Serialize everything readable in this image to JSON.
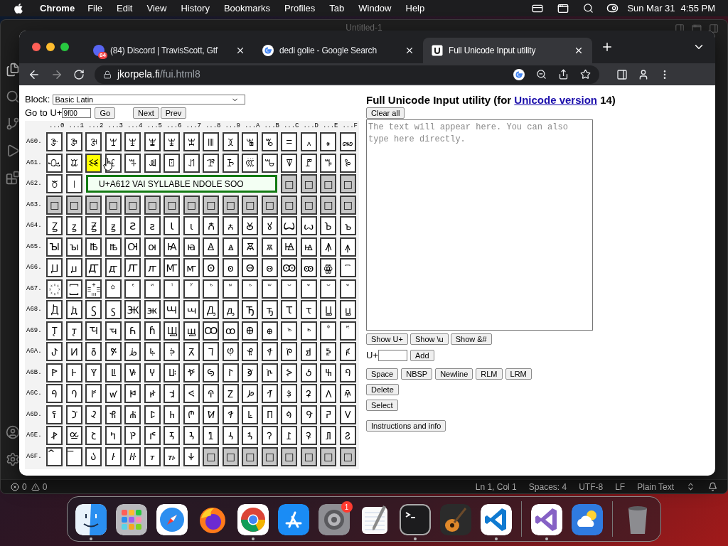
{
  "menubar": {
    "app_name": "Chrome",
    "menus": [
      "File",
      "Edit",
      "View",
      "History",
      "Bookmarks",
      "Profiles",
      "Tab",
      "Window",
      "Help"
    ],
    "date": "Sun Mar 31",
    "time": "4:55 PM"
  },
  "editor": {
    "title": "Untitled-1",
    "errors": "0",
    "warnings": "0",
    "status_items": [
      "Ln 1, Col 1",
      "Spaces: 4",
      "UTF-8",
      "LF",
      "Plain Text"
    ]
  },
  "browser": {
    "tabs": [
      {
        "kind": "discord",
        "title": "(84) Discord | TravisScott, Gtf",
        "badge": "84",
        "selected": false
      },
      {
        "kind": "google",
        "title": "dedi golie - Google Search",
        "selected": false
      },
      {
        "kind": "unicode",
        "title": "Full Unicode Input utility",
        "selected": true
      }
    ],
    "address": {
      "host": "jkorpela.fi",
      "path": "/fui.html8"
    }
  },
  "page": {
    "block_label": "Block:",
    "block_value": "Basic Latin",
    "goto_label": "Go to U+",
    "goto_value": "9f00",
    "go_button": "Go",
    "next_button": "Next",
    "prev_button": "Prev",
    "column_headers": [
      "...0",
      "...1",
      "...2",
      "...3",
      "...4",
      "...5",
      "...6",
      "...7",
      "...8",
      "...9",
      "...A",
      "...B",
      "...C",
      "...D",
      "...E",
      "...F"
    ],
    "rows": [
      {
        "label": "A60.",
        "cells": [
          {
            "ch": "ꘀ",
            "assigned": true,
            "selected": false
          },
          {
            "ch": "ꘁ",
            "assigned": true,
            "selected": false
          },
          {
            "ch": "ꘂ",
            "assigned": true,
            "selected": false
          },
          {
            "ch": "ꘃ",
            "assigned": true,
            "selected": false
          },
          {
            "ch": "ꘄ",
            "assigned": true,
            "selected": false
          },
          {
            "ch": "ꘅ",
            "assigned": true,
            "selected": false
          },
          {
            "ch": "ꘆ",
            "assigned": true,
            "selected": false
          },
          {
            "ch": "ꘇ",
            "assigned": true,
            "selected": false
          },
          {
            "ch": "ꘈ",
            "assigned": true,
            "selected": false
          },
          {
            "ch": "ꘉ",
            "assigned": true,
            "selected": false
          },
          {
            "ch": "ꘊ",
            "assigned": true,
            "selected": false
          },
          {
            "ch": "ꘋ",
            "assigned": true,
            "selected": false
          },
          {
            "ch": "ꘌ",
            "assigned": true,
            "selected": false
          },
          {
            "ch": "꘍",
            "assigned": true,
            "selected": false
          },
          {
            "ch": "꘎",
            "assigned": true,
            "selected": false
          },
          {
            "ch": "꘏",
            "assigned": true,
            "selected": false
          }
        ]
      },
      {
        "label": "A61.",
        "cells": [
          {
            "ch": "ꘐ",
            "assigned": true,
            "selected": false
          },
          {
            "ch": "ꘑ",
            "assigned": true,
            "selected": false
          },
          {
            "ch": "ꘒ",
            "assigned": true,
            "selected": true
          },
          {
            "ch": "ꘓ",
            "assigned": true,
            "selected": false
          },
          {
            "ch": "ꘔ",
            "assigned": true,
            "selected": false
          },
          {
            "ch": "ꘕ",
            "assigned": true,
            "selected": false
          },
          {
            "ch": "ꘖ",
            "assigned": true,
            "selected": false
          },
          {
            "ch": "ꘗ",
            "assigned": true,
            "selected": false
          },
          {
            "ch": "ꘘ",
            "assigned": true,
            "selected": false
          },
          {
            "ch": "ꘙ",
            "assigned": true,
            "selected": false
          },
          {
            "ch": "ꘚ",
            "assigned": true,
            "selected": false
          },
          {
            "ch": "ꘛ",
            "assigned": true,
            "selected": false
          },
          {
            "ch": "ꘜ",
            "assigned": true,
            "selected": false
          },
          {
            "ch": "ꘝ",
            "assigned": true,
            "selected": false
          },
          {
            "ch": "ꘞ",
            "assigned": true,
            "selected": false
          },
          {
            "ch": "ꘟ",
            "assigned": true,
            "selected": false
          }
        ]
      },
      {
        "label": "A62.",
        "cells": [
          {
            "ch": "꘠",
            "assigned": true,
            "selected": false
          },
          {
            "ch": "꘡",
            "assigned": true,
            "selected": false
          }
        ],
        "tooltip": "U+A612 VAI SYLLABLE NDOLE SOO",
        "cells_after": [
          {
            "ch": "□",
            "assigned": false,
            "selected": false
          },
          {
            "ch": "□",
            "assigned": false,
            "selected": false
          },
          {
            "ch": "□",
            "assigned": false,
            "selected": false
          },
          {
            "ch": "□",
            "assigned": false,
            "selected": false
          }
        ]
      },
      {
        "label": "A63.",
        "cells": [
          {
            "ch": "□",
            "assigned": false,
            "selected": false
          },
          {
            "ch": "□",
            "assigned": false,
            "selected": false
          },
          {
            "ch": "□",
            "assigned": false,
            "selected": false
          },
          {
            "ch": "□",
            "assigned": false,
            "selected": false
          },
          {
            "ch": "□",
            "assigned": false,
            "selected": false
          },
          {
            "ch": "□",
            "assigned": false,
            "selected": false
          },
          {
            "ch": "□",
            "assigned": false,
            "selected": false
          },
          {
            "ch": "□",
            "assigned": false,
            "selected": false
          },
          {
            "ch": "□",
            "assigned": false,
            "selected": false
          },
          {
            "ch": "□",
            "assigned": false,
            "selected": false
          },
          {
            "ch": "□",
            "assigned": false,
            "selected": false
          },
          {
            "ch": "□",
            "assigned": false,
            "selected": false
          },
          {
            "ch": "□",
            "assigned": false,
            "selected": false
          },
          {
            "ch": "□",
            "assigned": false,
            "selected": false
          },
          {
            "ch": "□",
            "assigned": false,
            "selected": false
          },
          {
            "ch": "□",
            "assigned": false,
            "selected": false
          }
        ]
      },
      {
        "label": "A64.",
        "cells": [
          {
            "ch": "Ꙁ",
            "assigned": true,
            "selected": false
          },
          {
            "ch": "ꙁ",
            "assigned": true,
            "selected": false
          },
          {
            "ch": "Ꙃ",
            "assigned": true,
            "selected": false
          },
          {
            "ch": "ꙃ",
            "assigned": true,
            "selected": false
          },
          {
            "ch": "Ꙅ",
            "assigned": true,
            "selected": false
          },
          {
            "ch": "ꙅ",
            "assigned": true,
            "selected": false
          },
          {
            "ch": "Ꙇ",
            "assigned": true,
            "selected": false
          },
          {
            "ch": "ꙇ",
            "assigned": true,
            "selected": false
          },
          {
            "ch": "Ꙉ",
            "assigned": true,
            "selected": false
          },
          {
            "ch": "ꙉ",
            "assigned": true,
            "selected": false
          },
          {
            "ch": "Ꙋ",
            "assigned": true,
            "selected": false
          },
          {
            "ch": "ꙋ",
            "assigned": true,
            "selected": false
          },
          {
            "ch": "Ꙍ",
            "assigned": true,
            "selected": false
          },
          {
            "ch": "ꙍ",
            "assigned": true,
            "selected": false
          },
          {
            "ch": "Ꙏ",
            "assigned": true,
            "selected": false
          },
          {
            "ch": "ꙏ",
            "assigned": true,
            "selected": false
          }
        ]
      },
      {
        "label": "A65.",
        "cells": [
          {
            "ch": "Ꙑ",
            "assigned": true,
            "selected": false
          },
          {
            "ch": "ꙑ",
            "assigned": true,
            "selected": false
          },
          {
            "ch": "Ꙓ",
            "assigned": true,
            "selected": false
          },
          {
            "ch": "ꙓ",
            "assigned": true,
            "selected": false
          },
          {
            "ch": "Ꙕ",
            "assigned": true,
            "selected": false
          },
          {
            "ch": "ꙕ",
            "assigned": true,
            "selected": false
          },
          {
            "ch": "Ꙗ",
            "assigned": true,
            "selected": false
          },
          {
            "ch": "ꙗ",
            "assigned": true,
            "selected": false
          },
          {
            "ch": "Ꙙ",
            "assigned": true,
            "selected": false
          },
          {
            "ch": "ꙙ",
            "assigned": true,
            "selected": false
          },
          {
            "ch": "Ꙛ",
            "assigned": true,
            "selected": false
          },
          {
            "ch": "ꙛ",
            "assigned": true,
            "selected": false
          },
          {
            "ch": "Ꙝ",
            "assigned": true,
            "selected": false
          },
          {
            "ch": "ꙝ",
            "assigned": true,
            "selected": false
          },
          {
            "ch": "Ꙟ",
            "assigned": true,
            "selected": false
          },
          {
            "ch": "ꙟ",
            "assigned": true,
            "selected": false
          }
        ]
      },
      {
        "label": "A66.",
        "cells": [
          {
            "ch": "Ꙡ",
            "assigned": true,
            "selected": false
          },
          {
            "ch": "ꙡ",
            "assigned": true,
            "selected": false
          },
          {
            "ch": "Ꙣ",
            "assigned": true,
            "selected": false
          },
          {
            "ch": "ꙣ",
            "assigned": true,
            "selected": false
          },
          {
            "ch": "Ꙥ",
            "assigned": true,
            "selected": false
          },
          {
            "ch": "ꙥ",
            "assigned": true,
            "selected": false
          },
          {
            "ch": "Ꙧ",
            "assigned": true,
            "selected": false
          },
          {
            "ch": "ꙧ",
            "assigned": true,
            "selected": false
          },
          {
            "ch": "Ꙩ",
            "assigned": true,
            "selected": false
          },
          {
            "ch": "ꙩ",
            "assigned": true,
            "selected": false
          },
          {
            "ch": "Ꙫ",
            "assigned": true,
            "selected": false
          },
          {
            "ch": "ꙫ",
            "assigned": true,
            "selected": false
          },
          {
            "ch": "Ꙭ",
            "assigned": true,
            "selected": false
          },
          {
            "ch": "ꙭ",
            "assigned": true,
            "selected": false
          },
          {
            "ch": "ꙮ",
            "assigned": true,
            "selected": false
          },
          {
            "ch": "꙯",
            "assigned": true,
            "selected": false
          }
        ]
      },
      {
        "label": "A67.",
        "cells": [
          {
            "ch": "꙰",
            "assigned": true,
            "selected": false
          },
          {
            "ch": "꙱",
            "assigned": true,
            "selected": false
          },
          {
            "ch": "꙲",
            "assigned": true,
            "selected": false
          },
          {
            "ch": "꙳",
            "assigned": true,
            "selected": false
          },
          {
            "ch": "ꙴ",
            "assigned": true,
            "selected": false
          },
          {
            "ch": "ꙵ",
            "assigned": true,
            "selected": false
          },
          {
            "ch": "ꙶ",
            "assigned": true,
            "selected": false
          },
          {
            "ch": "ꙷ",
            "assigned": true,
            "selected": false
          },
          {
            "ch": "ꙸ",
            "assigned": true,
            "selected": false
          },
          {
            "ch": "ꙹ",
            "assigned": true,
            "selected": false
          },
          {
            "ch": "ꙺ",
            "assigned": true,
            "selected": false
          },
          {
            "ch": "ꙻ",
            "assigned": true,
            "selected": false
          },
          {
            "ch": "꙼",
            "assigned": true,
            "selected": false
          },
          {
            "ch": "꙽",
            "assigned": true,
            "selected": false
          },
          {
            "ch": "꙾",
            "assigned": true,
            "selected": false
          },
          {
            "ch": "ꙿ",
            "assigned": true,
            "selected": false
          }
        ]
      },
      {
        "label": "A68.",
        "cells": [
          {
            "ch": "Ꚁ",
            "assigned": true,
            "selected": false
          },
          {
            "ch": "ꚁ",
            "assigned": true,
            "selected": false
          },
          {
            "ch": "Ꚃ",
            "assigned": true,
            "selected": false
          },
          {
            "ch": "ꚃ",
            "assigned": true,
            "selected": false
          },
          {
            "ch": "Ꚅ",
            "assigned": true,
            "selected": false
          },
          {
            "ch": "ꚅ",
            "assigned": true,
            "selected": false
          },
          {
            "ch": "Ꚇ",
            "assigned": true,
            "selected": false
          },
          {
            "ch": "ꚇ",
            "assigned": true,
            "selected": false
          },
          {
            "ch": "Ꚉ",
            "assigned": true,
            "selected": false
          },
          {
            "ch": "ꚉ",
            "assigned": true,
            "selected": false
          },
          {
            "ch": "Ꚋ",
            "assigned": true,
            "selected": false
          },
          {
            "ch": "ꚋ",
            "assigned": true,
            "selected": false
          },
          {
            "ch": "Ꚍ",
            "assigned": true,
            "selected": false
          },
          {
            "ch": "ꚍ",
            "assigned": true,
            "selected": false
          },
          {
            "ch": "Ꚏ",
            "assigned": true,
            "selected": false
          },
          {
            "ch": "ꚏ",
            "assigned": true,
            "selected": false
          }
        ]
      },
      {
        "label": "A69.",
        "cells": [
          {
            "ch": "Ꚑ",
            "assigned": true,
            "selected": false
          },
          {
            "ch": "ꚑ",
            "assigned": true,
            "selected": false
          },
          {
            "ch": "Ꚓ",
            "assigned": true,
            "selected": false
          },
          {
            "ch": "ꚓ",
            "assigned": true,
            "selected": false
          },
          {
            "ch": "Ꚕ",
            "assigned": true,
            "selected": false
          },
          {
            "ch": "ꚕ",
            "assigned": true,
            "selected": false
          },
          {
            "ch": "Ꚗ",
            "assigned": true,
            "selected": false
          },
          {
            "ch": "ꚗ",
            "assigned": true,
            "selected": false
          },
          {
            "ch": "Ꚙ",
            "assigned": true,
            "selected": false
          },
          {
            "ch": "ꚙ",
            "assigned": true,
            "selected": false
          },
          {
            "ch": "Ꚛ",
            "assigned": true,
            "selected": false
          },
          {
            "ch": "ꚛ",
            "assigned": true,
            "selected": false
          },
          {
            "ch": "ꚜ",
            "assigned": true,
            "selected": false
          },
          {
            "ch": "ꚝ",
            "assigned": true,
            "selected": false
          },
          {
            "ch": "ꚞ",
            "assigned": true,
            "selected": false
          },
          {
            "ch": "ꚟ",
            "assigned": true,
            "selected": false
          }
        ]
      },
      {
        "label": "A6A.",
        "cells": [
          {
            "ch": "ꚠ",
            "assigned": true,
            "selected": false
          },
          {
            "ch": "ꚡ",
            "assigned": true,
            "selected": false
          },
          {
            "ch": "ꚢ",
            "assigned": true,
            "selected": false
          },
          {
            "ch": "ꚣ",
            "assigned": true,
            "selected": false
          },
          {
            "ch": "ꚤ",
            "assigned": true,
            "selected": false
          },
          {
            "ch": "ꚥ",
            "assigned": true,
            "selected": false
          },
          {
            "ch": "ꚦ",
            "assigned": true,
            "selected": false
          },
          {
            "ch": "ꚧ",
            "assigned": true,
            "selected": false
          },
          {
            "ch": "ꚨ",
            "assigned": true,
            "selected": false
          },
          {
            "ch": "ꚩ",
            "assigned": true,
            "selected": false
          },
          {
            "ch": "ꚪ",
            "assigned": true,
            "selected": false
          },
          {
            "ch": "ꚫ",
            "assigned": true,
            "selected": false
          },
          {
            "ch": "ꚬ",
            "assigned": true,
            "selected": false
          },
          {
            "ch": "ꚭ",
            "assigned": true,
            "selected": false
          },
          {
            "ch": "ꚮ",
            "assigned": true,
            "selected": false
          },
          {
            "ch": "ꚯ",
            "assigned": true,
            "selected": false
          }
        ]
      },
      {
        "label": "A6B.",
        "cells": [
          {
            "ch": "ꚰ",
            "assigned": true,
            "selected": false
          },
          {
            "ch": "ꚱ",
            "assigned": true,
            "selected": false
          },
          {
            "ch": "ꚲ",
            "assigned": true,
            "selected": false
          },
          {
            "ch": "ꚳ",
            "assigned": true,
            "selected": false
          },
          {
            "ch": "ꚴ",
            "assigned": true,
            "selected": false
          },
          {
            "ch": "ꚵ",
            "assigned": true,
            "selected": false
          },
          {
            "ch": "ꚶ",
            "assigned": true,
            "selected": false
          },
          {
            "ch": "ꚷ",
            "assigned": true,
            "selected": false
          },
          {
            "ch": "ꚸ",
            "assigned": true,
            "selected": false
          },
          {
            "ch": "ꚹ",
            "assigned": true,
            "selected": false
          },
          {
            "ch": "ꚺ",
            "assigned": true,
            "selected": false
          },
          {
            "ch": "ꚻ",
            "assigned": true,
            "selected": false
          },
          {
            "ch": "ꚼ",
            "assigned": true,
            "selected": false
          },
          {
            "ch": "ꚽ",
            "assigned": true,
            "selected": false
          },
          {
            "ch": "ꚾ",
            "assigned": true,
            "selected": false
          },
          {
            "ch": "ꚿ",
            "assigned": true,
            "selected": false
          }
        ]
      },
      {
        "label": "A6C.",
        "cells": [
          {
            "ch": "ꛀ",
            "assigned": true,
            "selected": false
          },
          {
            "ch": "ꛁ",
            "assigned": true,
            "selected": false
          },
          {
            "ch": "ꛂ",
            "assigned": true,
            "selected": false
          },
          {
            "ch": "ꛃ",
            "assigned": true,
            "selected": false
          },
          {
            "ch": "ꛄ",
            "assigned": true,
            "selected": false
          },
          {
            "ch": "ꛅ",
            "assigned": true,
            "selected": false
          },
          {
            "ch": "ꛆ",
            "assigned": true,
            "selected": false
          },
          {
            "ch": "ꛇ",
            "assigned": true,
            "selected": false
          },
          {
            "ch": "ꛈ",
            "assigned": true,
            "selected": false
          },
          {
            "ch": "ꛉ",
            "assigned": true,
            "selected": false
          },
          {
            "ch": "ꛊ",
            "assigned": true,
            "selected": false
          },
          {
            "ch": "ꛋ",
            "assigned": true,
            "selected": false
          },
          {
            "ch": "ꛌ",
            "assigned": true,
            "selected": false
          },
          {
            "ch": "ꛍ",
            "assigned": true,
            "selected": false
          },
          {
            "ch": "ꛎ",
            "assigned": true,
            "selected": false
          },
          {
            "ch": "ꛏ",
            "assigned": true,
            "selected": false
          }
        ]
      },
      {
        "label": "A6D.",
        "cells": [
          {
            "ch": "ꛐ",
            "assigned": true,
            "selected": false
          },
          {
            "ch": "ꛑ",
            "assigned": true,
            "selected": false
          },
          {
            "ch": "ꛒ",
            "assigned": true,
            "selected": false
          },
          {
            "ch": "ꛓ",
            "assigned": true,
            "selected": false
          },
          {
            "ch": "ꛔ",
            "assigned": true,
            "selected": false
          },
          {
            "ch": "ꛕ",
            "assigned": true,
            "selected": false
          },
          {
            "ch": "ꛖ",
            "assigned": true,
            "selected": false
          },
          {
            "ch": "ꛗ",
            "assigned": true,
            "selected": false
          },
          {
            "ch": "ꛘ",
            "assigned": true,
            "selected": false
          },
          {
            "ch": "ꛙ",
            "assigned": true,
            "selected": false
          },
          {
            "ch": "ꛚ",
            "assigned": true,
            "selected": false
          },
          {
            "ch": "ꛛ",
            "assigned": true,
            "selected": false
          },
          {
            "ch": "ꛜ",
            "assigned": true,
            "selected": false
          },
          {
            "ch": "ꛝ",
            "assigned": true,
            "selected": false
          },
          {
            "ch": "ꛞ",
            "assigned": true,
            "selected": false
          },
          {
            "ch": "ꛟ",
            "assigned": true,
            "selected": false
          }
        ]
      },
      {
        "label": "A6E.",
        "cells": [
          {
            "ch": "ꛠ",
            "assigned": true,
            "selected": false
          },
          {
            "ch": "ꛡ",
            "assigned": true,
            "selected": false
          },
          {
            "ch": "ꛢ",
            "assigned": true,
            "selected": false
          },
          {
            "ch": "ꛣ",
            "assigned": true,
            "selected": false
          },
          {
            "ch": "ꛤ",
            "assigned": true,
            "selected": false
          },
          {
            "ch": "ꛥ",
            "assigned": true,
            "selected": false
          },
          {
            "ch": "ꛦ",
            "assigned": true,
            "selected": false
          },
          {
            "ch": "ꛧ",
            "assigned": true,
            "selected": false
          },
          {
            "ch": "ꛨ",
            "assigned": true,
            "selected": false
          },
          {
            "ch": "ꛩ",
            "assigned": true,
            "selected": false
          },
          {
            "ch": "ꛪ",
            "assigned": true,
            "selected": false
          },
          {
            "ch": "ꛫ",
            "assigned": true,
            "selected": false
          },
          {
            "ch": "ꛬ",
            "assigned": true,
            "selected": false
          },
          {
            "ch": "ꛭ",
            "assigned": true,
            "selected": false
          },
          {
            "ch": "ꛮ",
            "assigned": true,
            "selected": false
          },
          {
            "ch": "ꛯ",
            "assigned": true,
            "selected": false
          }
        ]
      },
      {
        "label": "A6F.",
        "cells": [
          {
            "ch": "꛰",
            "assigned": true,
            "selected": false
          },
          {
            "ch": "꛱",
            "assigned": true,
            "selected": false
          },
          {
            "ch": "꛲",
            "assigned": true,
            "selected": false
          },
          {
            "ch": "꛳",
            "assigned": true,
            "selected": false
          },
          {
            "ch": "꛴",
            "assigned": true,
            "selected": false
          },
          {
            "ch": "꛵",
            "assigned": true,
            "selected": false
          },
          {
            "ch": "꛶",
            "assigned": true,
            "selected": false
          },
          {
            "ch": "꛷",
            "assigned": true,
            "selected": false
          },
          {
            "ch": "□",
            "assigned": false,
            "selected": false
          },
          {
            "ch": "□",
            "assigned": false,
            "selected": false
          },
          {
            "ch": "□",
            "assigned": false,
            "selected": false
          },
          {
            "ch": "□",
            "assigned": false,
            "selected": false
          },
          {
            "ch": "□",
            "assigned": false,
            "selected": false
          },
          {
            "ch": "□",
            "assigned": false,
            "selected": false
          },
          {
            "ch": "□",
            "assigned": false,
            "selected": false
          },
          {
            "ch": "□",
            "assigned": false,
            "selected": false
          }
        ]
      }
    ],
    "title_before": "Full Unicode Input utility (for ",
    "title_link": "Unicode version",
    "title_after": " 14)",
    "clear_button": "Clear all",
    "text_placeholder": "The text will appear here. You can also type here directly.",
    "show_buttons": [
      "Show U+",
      "Show \\u",
      "Show &#"
    ],
    "add_label": "U+",
    "add_button": "Add",
    "insert_buttons": [
      "Space",
      "NBSP",
      "Newline",
      "RLM",
      "LRM"
    ],
    "delete_button": "Delete",
    "select_button": "Select",
    "info_button": "Instructions and info"
  },
  "dock": [
    {
      "kind": "finder",
      "running": true
    },
    {
      "kind": "launchpad",
      "running": false
    },
    {
      "kind": "safari",
      "running": false
    },
    {
      "kind": "firefox",
      "running": false
    },
    {
      "kind": "chrome",
      "running": true
    },
    {
      "kind": "appstore",
      "running": false
    },
    {
      "kind": "settings",
      "running": false,
      "badge": "1"
    },
    {
      "kind": "textedit",
      "running": false
    },
    {
      "kind": "terminal",
      "running": true
    },
    {
      "kind": "guitar",
      "running": false
    },
    {
      "kind": "vscode",
      "running": true
    },
    {
      "kind": "separator"
    },
    {
      "kind": "visualstudio",
      "running": true
    },
    {
      "kind": "weather",
      "running": false
    },
    {
      "kind": "separator"
    },
    {
      "kind": "trash",
      "running": false
    }
  ]
}
